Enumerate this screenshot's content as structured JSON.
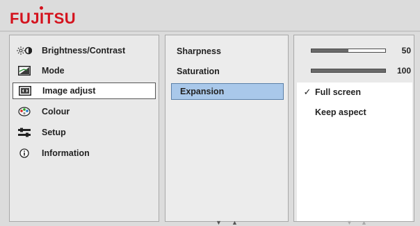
{
  "brand": {
    "logo_text": "FUJITSU",
    "color": "#d4121d"
  },
  "main_menu": {
    "items": [
      {
        "label": "Brightness/Contrast",
        "icon": "brightness-contrast-icon",
        "selected": false
      },
      {
        "label": "Mode",
        "icon": "mode-icon",
        "selected": false
      },
      {
        "label": "Image adjust",
        "icon": "image-adjust-icon",
        "selected": true
      },
      {
        "label": "Colour",
        "icon": "colour-palette-icon",
        "selected": false
      },
      {
        "label": "Setup",
        "icon": "setup-sliders-icon",
        "selected": false
      },
      {
        "label": "Information",
        "icon": "info-icon",
        "selected": false
      }
    ]
  },
  "sub_menu": {
    "items": [
      {
        "label": "Sharpness",
        "selected": false
      },
      {
        "label": "Saturation",
        "selected": false
      },
      {
        "label": "Expansion",
        "selected": true
      }
    ],
    "selection_color": "#a9c8ea"
  },
  "values": {
    "sharpness": {
      "value": "50",
      "fraction": 0.5
    },
    "saturation": {
      "value": "100",
      "fraction": 1.0
    }
  },
  "expansion_options": {
    "items": [
      {
        "label": "Full screen",
        "checked": true,
        "check_mark": "✓"
      },
      {
        "label": "Keep aspect",
        "checked": false,
        "check_mark": ""
      }
    ]
  },
  "nav_hints": {
    "down": "▼",
    "up": "▲"
  }
}
